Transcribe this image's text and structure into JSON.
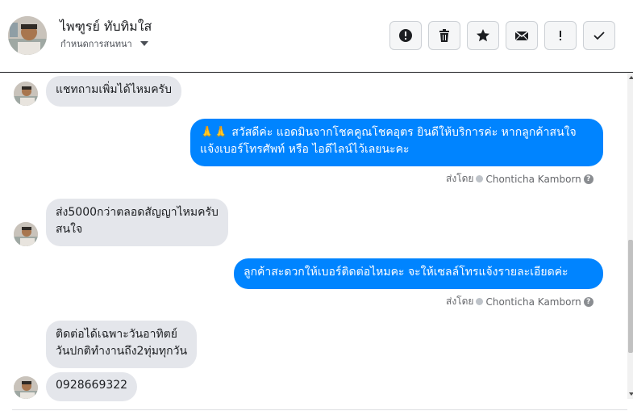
{
  "contact": {
    "name": "ไพฑูรย์ ทับทิมใส",
    "assign_label": "กำหนดการสนทนา"
  },
  "toolbar": {
    "buttons": [
      {
        "icon": "alert-circle-icon",
        "name": "report-button"
      },
      {
        "icon": "trash-icon",
        "name": "delete-button"
      },
      {
        "icon": "star-icon",
        "name": "star-button"
      },
      {
        "icon": "mail-icon",
        "name": "mark-unread-button"
      },
      {
        "icon": "exclamation-icon",
        "name": "spam-button"
      },
      {
        "icon": "check-icon",
        "name": "done-button"
      }
    ]
  },
  "messages": [
    {
      "dir": "in",
      "lines": [
        "แชทถามเพิ่มได้ไหมครับ"
      ]
    },
    {
      "dir": "out",
      "lines": [
        "🙏🙏 สวัสดีค่ะ แอดมินจากโชคคูณโชคอุตร ยินดีให้บริการค่ะ หากลูกค้าสนใจ",
        "แจ้งเบอร์โทรศัพท์ หรือ ไอดีไลน์ไว้เลยนะคะ"
      ]
    },
    {
      "dir": "in",
      "lines": [
        "ส่ง5000กว่าตลอดสัญญาไหมครับ",
        "สนใจ"
      ]
    },
    {
      "dir": "out",
      "lines": [
        "ลูกค้าสะดวกให้เบอร์ติดต่อไหมคะ จะให้เซลล์โทรแจ้งรายละเอียดค่ะ"
      ]
    },
    {
      "dir": "in",
      "lines": [
        "ติดต่อได้เฉพาะวันอาทิตย์",
        "วันปกติทำงานถึง2ทุ่มทุกวัน"
      ]
    },
    {
      "dir": "in",
      "lines": [
        "0928669322"
      ]
    }
  ],
  "sender_meta": {
    "prefix": "ส่งโดย",
    "agent": "Chonticha Kamborn",
    "help": "?"
  },
  "colors": {
    "outgoing_bubble": "#0084ff",
    "incoming_bubble": "#e4e6eb"
  }
}
